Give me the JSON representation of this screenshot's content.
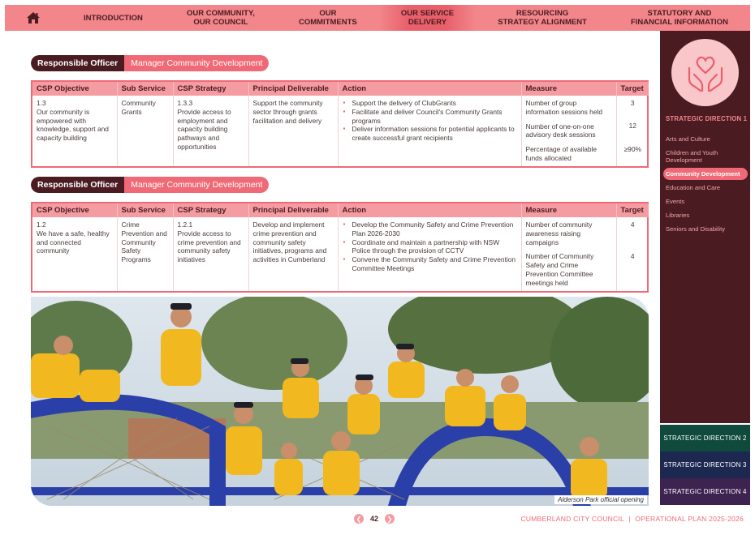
{
  "nav": {
    "home_icon": "home-icon",
    "items": [
      {
        "label": "INTRODUCTION"
      },
      {
        "label": "OUR COMMUNITY,\nOUR COUNCIL"
      },
      {
        "label": "OUR\nCOMMITMENTS"
      },
      {
        "label": "OUR SERVICE\nDELIVERY",
        "active": true
      },
      {
        "label": "RESOURCING\nSTRATEGY ALIGNMENT"
      },
      {
        "label": "STATUTORY AND\nFINANCIAL INFORMATION"
      }
    ]
  },
  "officer1": {
    "label": "Responsible Officer",
    "value": "Manager Community Development"
  },
  "officer2": {
    "label": "Responsible Officer",
    "value": "Manager Community Development"
  },
  "table_headers": [
    "CSP Objective",
    "Sub Service",
    "CSP Strategy",
    "Principal Deliverable",
    "Action",
    "Measure",
    "Target"
  ],
  "table1": {
    "objective": "1.3\nOur community is empowered with knowledge, support and capacity building",
    "sub_service": "Community Grants",
    "strategy": "1.3.3\nProvide access to employment and capacity building pathways and opportunities",
    "deliverable": "Support the community sector through grants facilitation and delivery",
    "actions": [
      "Support the delivery of ClubGrants",
      "Facilitate and deliver Council's Community Grants programs",
      "Deliver information sessions for potential applicants to create successful grant recipients"
    ],
    "measures": [
      "Number of group information sessions held",
      "Number of one-on-one advisory desk sessions",
      "Percentage of available funds allocated"
    ],
    "targets": [
      "3",
      "12",
      "≥90%"
    ]
  },
  "table2": {
    "objective": "1.2\nWe have a safe, healthy and connected community",
    "sub_service": "Crime Prevention and Community Safety Programs",
    "strategy": "1.2.1\nProvide access to crime prevention and community safety initiatives",
    "deliverable": "Develop and implement crime prevention and community safety initiatives, programs and activities in Cumberland",
    "actions": [
      "Develop the Community Safety and Crime Prevention Plan 2026-2030",
      "Coordinate and maintain a partnership with NSW Police through the provision of CCTV",
      "Convene the Community Safety and Crime Prevention Committee Meetings"
    ],
    "measures": [
      "Number of community awareness raising campaigns",
      "Number of Community Safety and Crime Prevention Committee meetings held"
    ],
    "targets": [
      "4",
      "4"
    ]
  },
  "photo": {
    "caption": "Alderson Park official opening"
  },
  "sidebar": {
    "icon": "heart-hands-icon",
    "title": "STRATEGIC DIRECTION 1",
    "items": [
      {
        "label": "Arts and Culture"
      },
      {
        "label": "Children and Youth Development"
      },
      {
        "label": "Community Development",
        "active": true
      },
      {
        "label": "Education and Care"
      },
      {
        "label": "Events"
      },
      {
        "label": "Libraries"
      },
      {
        "label": "Seniors and Disability"
      }
    ],
    "blocks": [
      {
        "label": "STRATEGIC DIRECTION 2",
        "color": "#0f4a3c"
      },
      {
        "label": "STRATEGIC DIRECTION 3",
        "color": "#1c2850"
      },
      {
        "label": "STRATEGIC DIRECTION 4",
        "color": "#3c2350"
      }
    ]
  },
  "footer": {
    "page": "42",
    "org": "CUMBERLAND CITY COUNCIL",
    "separator": "|",
    "plan": "OPERATIONAL PLAN 2025-2026"
  },
  "colors": {
    "accent": "#ef6a76",
    "dark": "#4a1c22",
    "header": "#f2868b"
  }
}
